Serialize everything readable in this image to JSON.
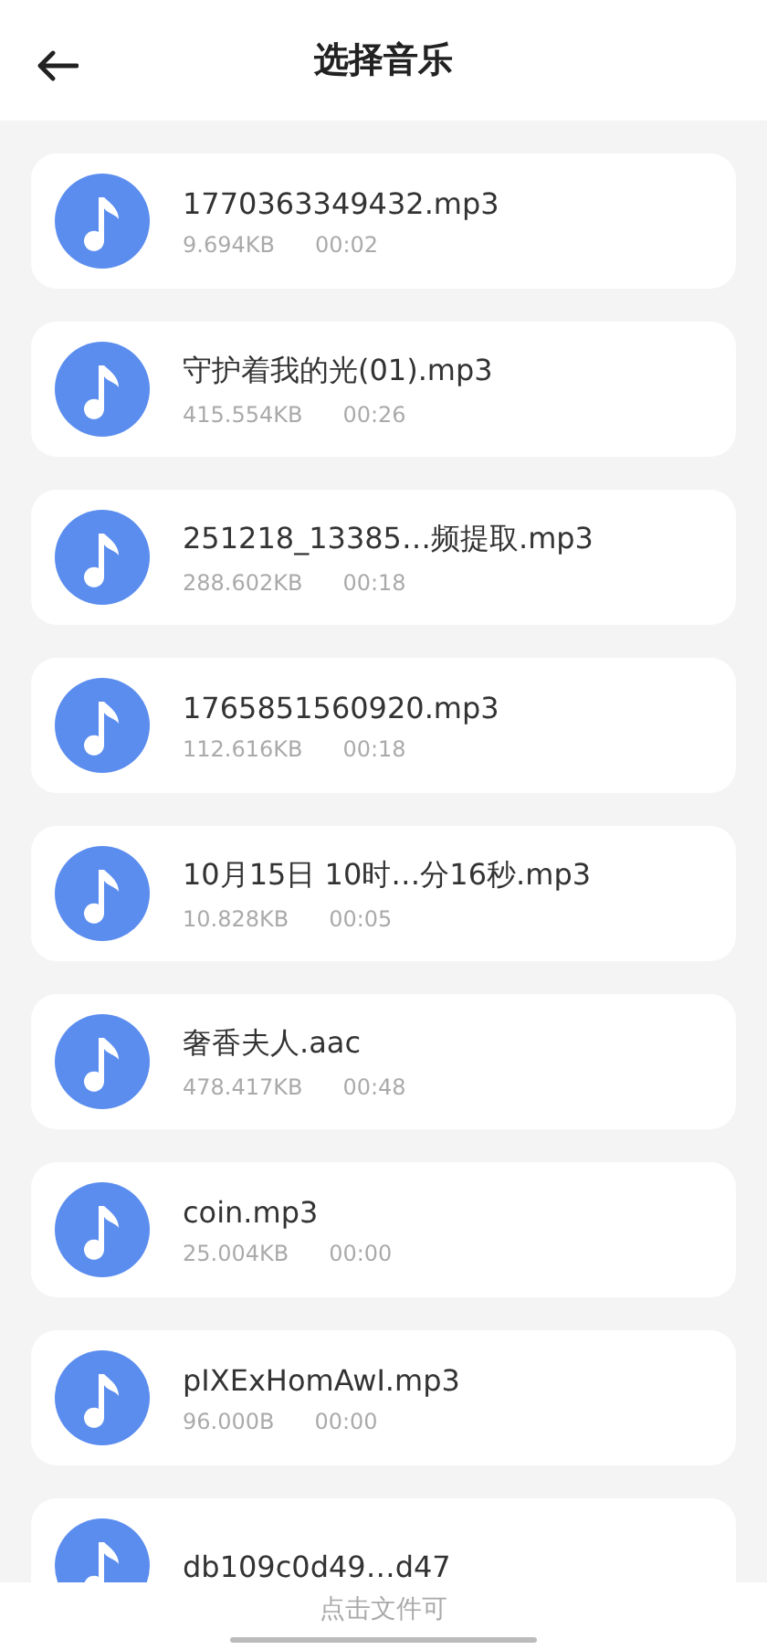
{
  "header": {
    "title": "选择音乐"
  },
  "files": [
    {
      "name": "1770363349432.mp3",
      "size": "9.694KB",
      "duration": "00:02"
    },
    {
      "name": "守护着我的光(01).mp3",
      "size": "415.554KB",
      "duration": "00:26"
    },
    {
      "name": "251218_13385…频提取.mp3",
      "size": "288.602KB",
      "duration": "00:18"
    },
    {
      "name": "1765851560920.mp3",
      "size": "112.616KB",
      "duration": "00:18"
    },
    {
      "name": "10月15日 10时…分16秒.mp3",
      "size": "10.828KB",
      "duration": "00:05"
    },
    {
      "name": "奢香夫人.aac",
      "size": "478.417KB",
      "duration": "00:48"
    },
    {
      "name": "coin.mp3",
      "size": "25.004KB",
      "duration": "00:00"
    },
    {
      "name": "pIXExHomAwI.mp3",
      "size": "96.000B",
      "duration": "00:00"
    },
    {
      "name": "db109c0d49…d47"
    }
  ],
  "hint": "点击文件可"
}
